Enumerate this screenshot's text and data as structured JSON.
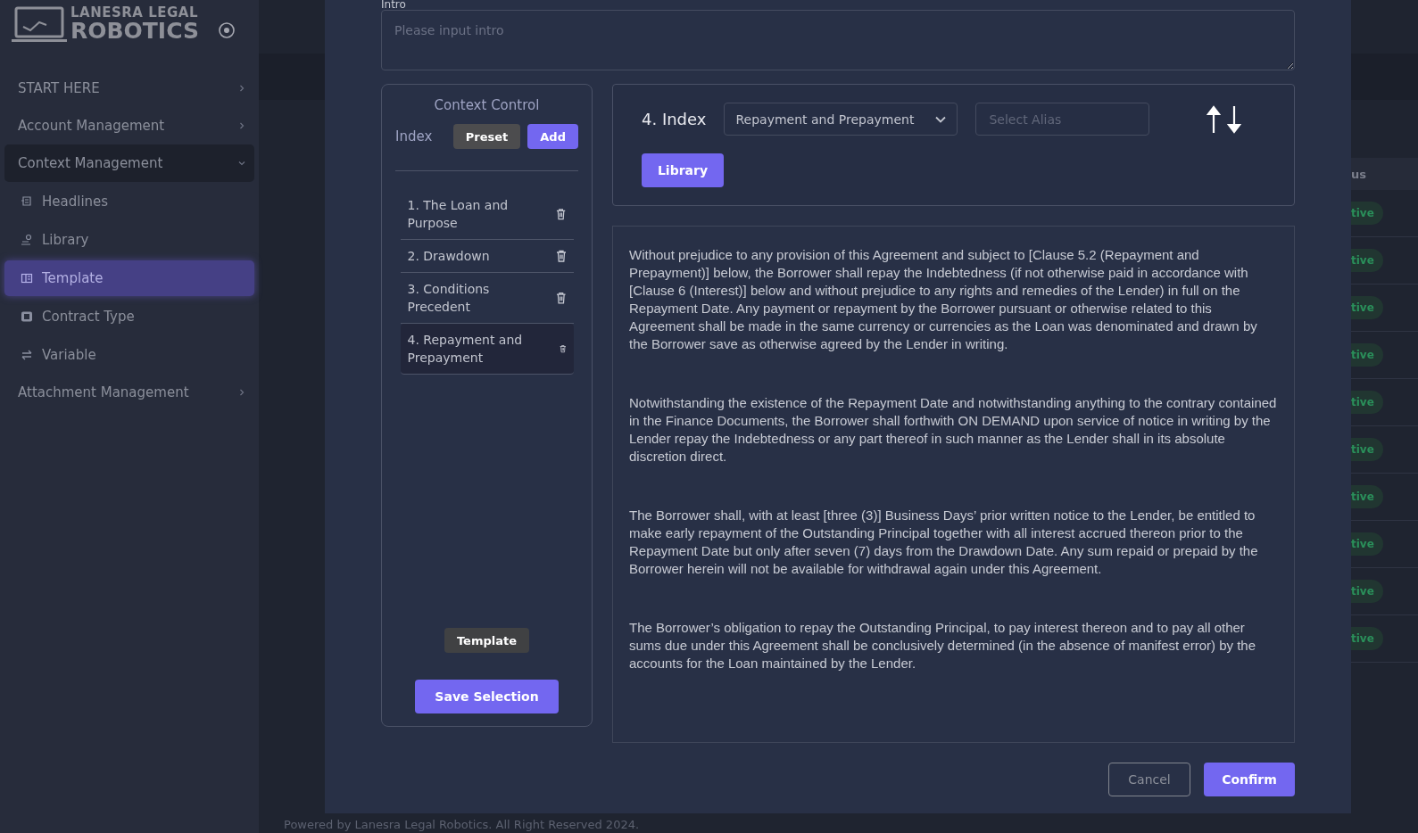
{
  "sidebar": {
    "logo": {
      "line1": "LANESRA LEGAL",
      "line2": "ROBOTICS"
    },
    "items": [
      {
        "label": "START HERE",
        "expanded": false
      },
      {
        "label": "Account Management",
        "expanded": false
      },
      {
        "label": "Context Management",
        "expanded": true,
        "children": [
          {
            "label": "Headlines",
            "selected": false
          },
          {
            "label": "Library",
            "selected": false
          },
          {
            "label": "Template",
            "selected": true
          },
          {
            "label": "Contract Type",
            "selected": false
          },
          {
            "label": "Variable",
            "selected": false
          }
        ]
      },
      {
        "label": "Attachment Management",
        "expanded": false
      }
    ]
  },
  "background_table": {
    "column_header": "us",
    "status_badges": [
      "tive",
      "tive",
      "tive",
      "tive",
      "tive",
      "tive",
      "tive",
      "tive",
      "tive",
      "tive"
    ]
  },
  "footer": "Powered by Lanesra Legal Robotics. All Right Reserved 2024.",
  "modal": {
    "intro": {
      "label": "Intro",
      "placeholder": "Please input intro"
    },
    "context_control": {
      "title": "Context Control",
      "index_label": "Index",
      "preset_button": "Preset",
      "add_button": "Add",
      "items": [
        {
          "label": "1. The Loan and Purpose",
          "selected": false
        },
        {
          "label": "2. Drawdown",
          "selected": false
        },
        {
          "label": "3. Conditions Precedent",
          "selected": false
        },
        {
          "label": "4. Repayment and Prepayment",
          "selected": true
        }
      ],
      "template_button": "Template",
      "save_button": "Save Selection"
    },
    "section_editor": {
      "heading": "4. Index",
      "dropdown_value": "Repayment and Prepayment",
      "alias_placeholder": "Select Alias",
      "library_button": "Library"
    },
    "paragraphs": [
      "Without prejudice to any provision of this Agreement and subject to [Clause 5.2 (Repayment and Prepayment)] below, the Borrower shall repay the Indebtedness (if not otherwise paid in accordance with [Clause 6 (Interest)]  below and without prejudice to any rights and remedies of the Lender) in full on the Repayment Date. Any payment or repayment by the Borrower pursuant or otherwise related to this Agreement shall be made in the same currency or currencies as the Loan was denominated and drawn by the Borrower save as otherwise agreed by the Lender in writing.",
      "Notwithstanding the existence of the Repayment Date and notwithstanding anything to the contrary contained in the Finance Documents, the Borrower shall forthwith ON DEMAND upon service of notice in writing by the Lender repay the Indebtedness or any part thereof in such manner as the Lender shall in its absolute discretion direct.",
      "The Borrower shall, with at least [three (3)] Business Days’ prior written notice to the Lender, be entitled to make early repayment of the Outstanding Principal together with all interest accrued thereon prior to the Repayment Date but only after seven (7) days from the Drawdown Date. Any sum repaid or prepaid by the Borrower herein will not be available for withdrawal again under this Agreement.",
      "The Borrower’s obligation to repay the Outstanding Principal, to pay interest thereon and to pay all other sums due under this Agreement shall be conclusively determined (in the absence of manifest error) by the accounts for the Loan maintained by the Lender."
    ],
    "cancel_button": "Cancel",
    "confirm_button": "Confirm"
  }
}
